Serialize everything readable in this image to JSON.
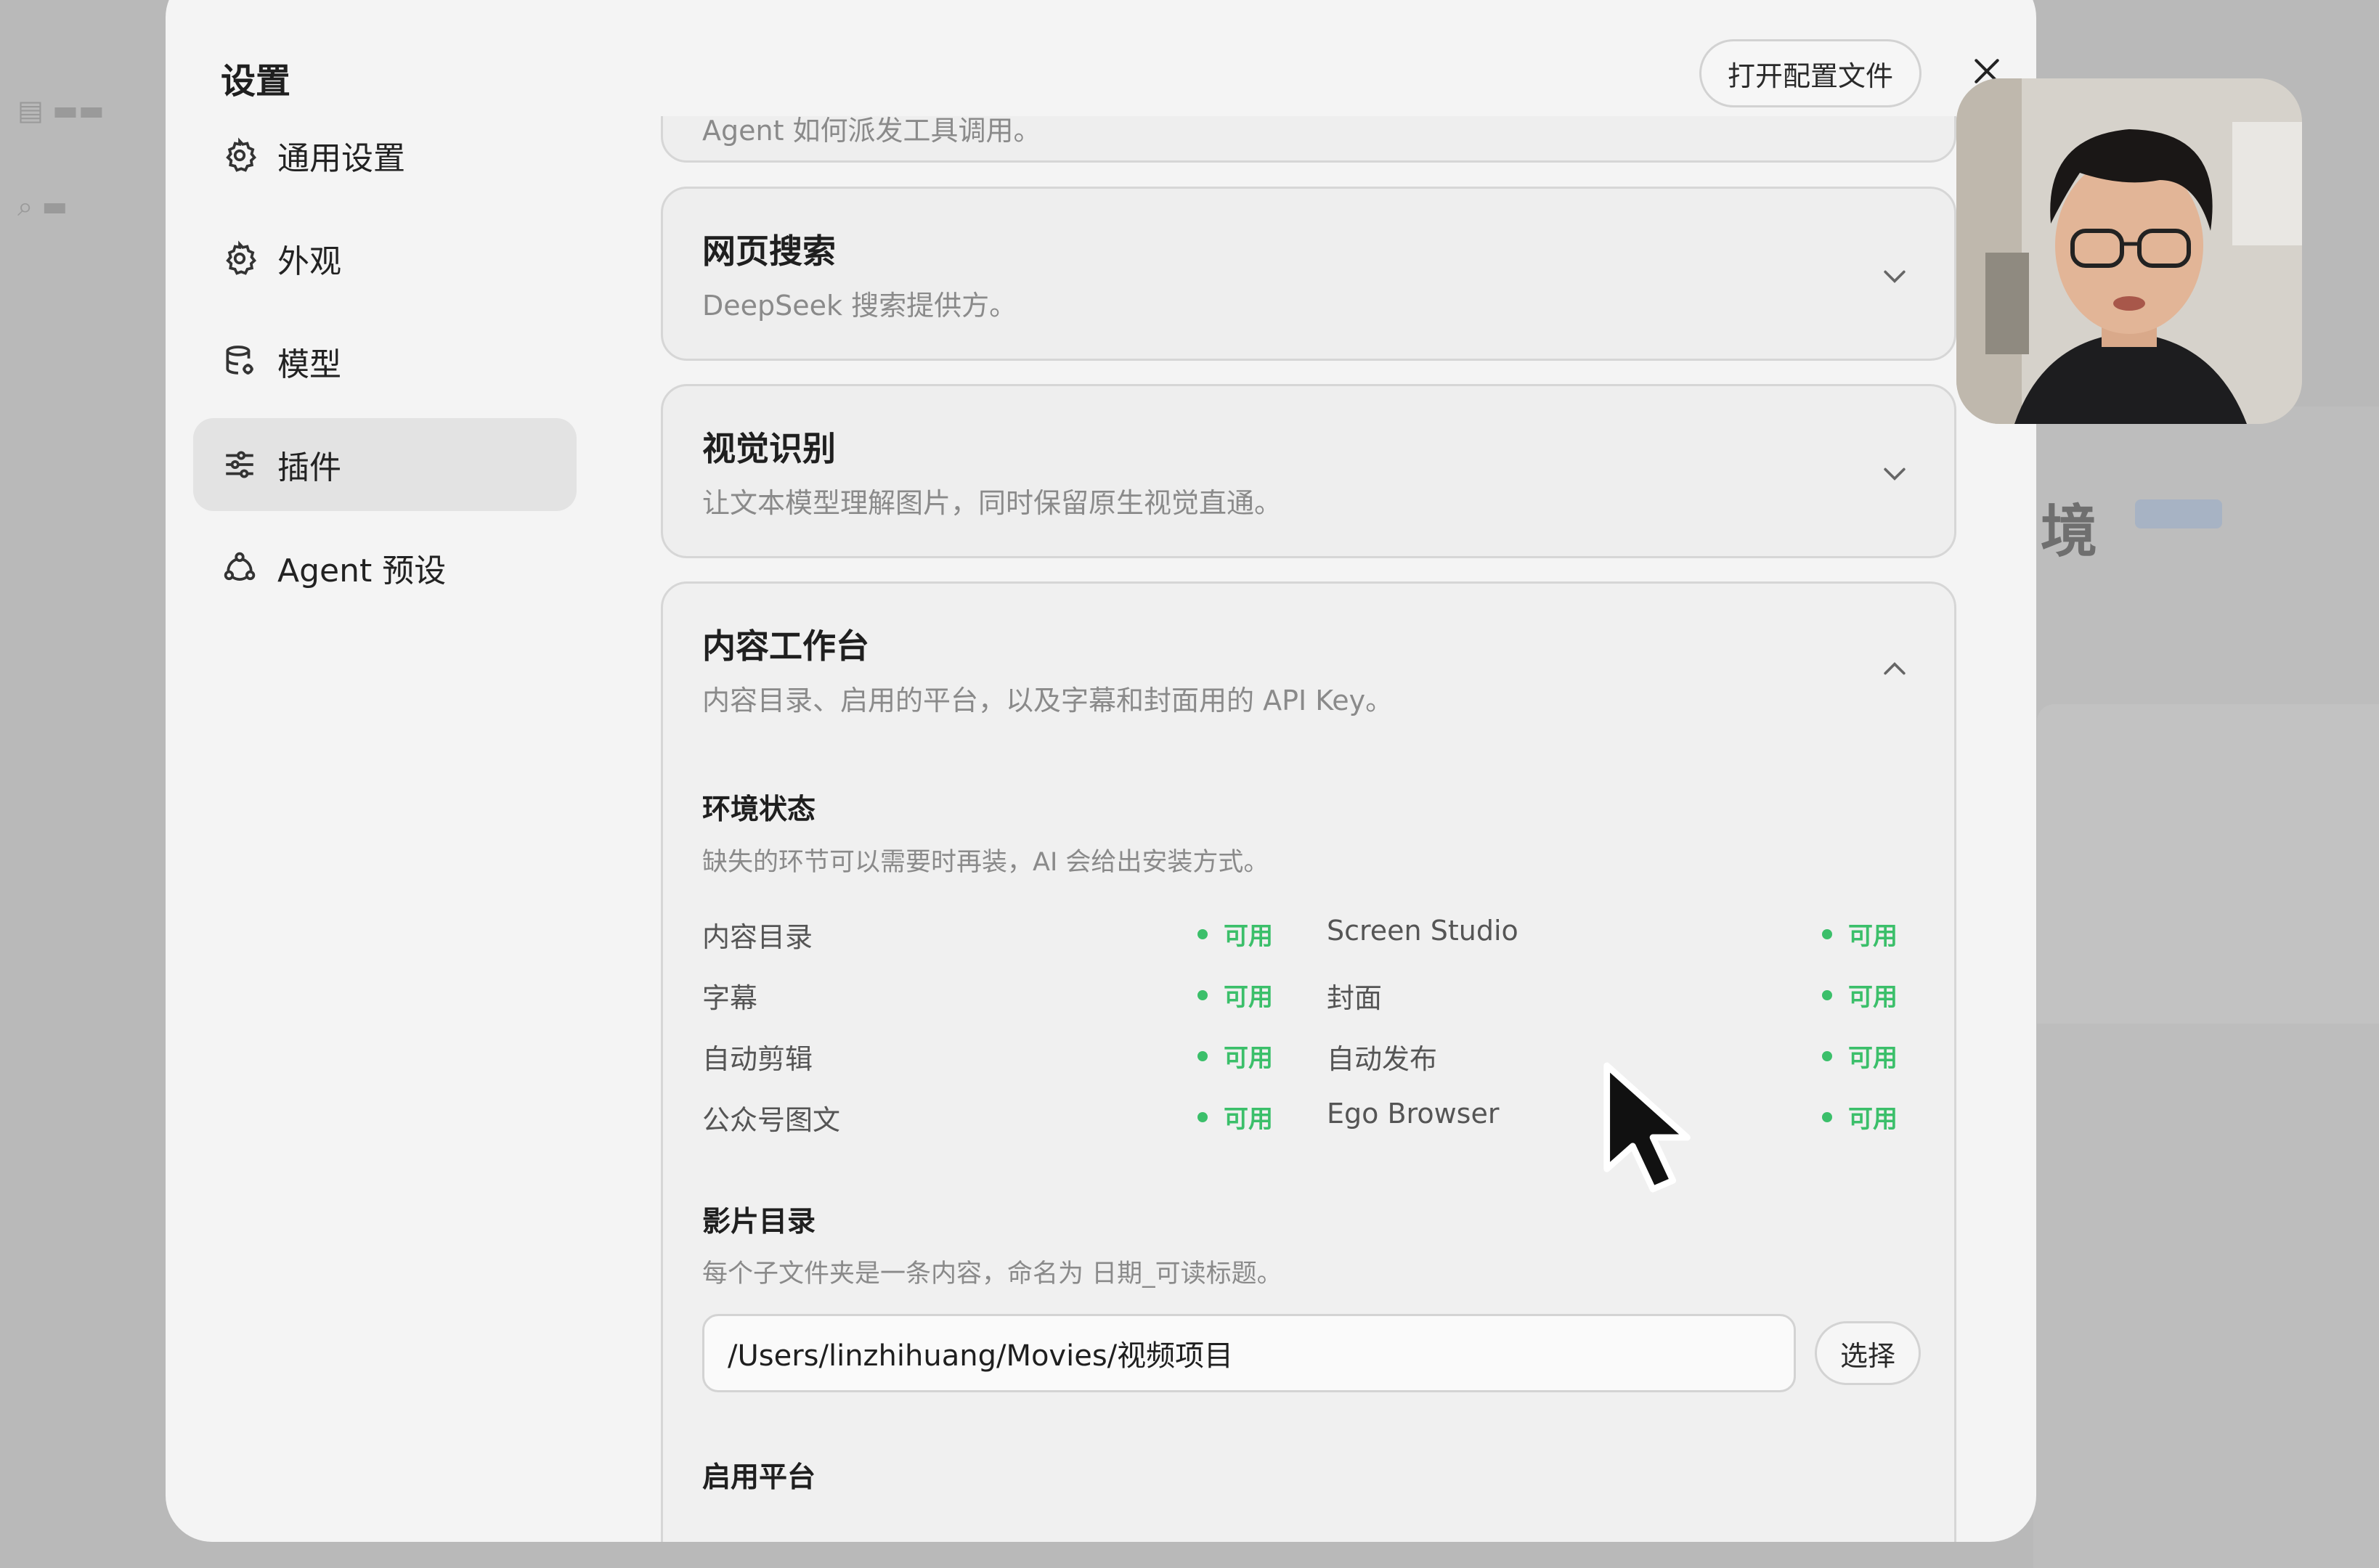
{
  "dialog": {
    "title": "设置",
    "open_config_label": "打开配置文件"
  },
  "nav": {
    "items": [
      {
        "label": "通用设置",
        "icon": "gear-icon"
      },
      {
        "label": "外观",
        "icon": "gear-icon"
      },
      {
        "label": "模型",
        "icon": "database-icon"
      },
      {
        "label": "插件",
        "icon": "sliders-icon",
        "active": true
      },
      {
        "label": "Agent 预设",
        "icon": "agent-icon"
      }
    ]
  },
  "cards": {
    "partial_desc": "Agent 如何派发工具调用。",
    "web_search": {
      "title": "网页搜索",
      "desc": "DeepSeek 搜索提供方。"
    },
    "vision": {
      "title": "视觉识别",
      "desc": "让文本模型理解图片，同时保留原生视觉直通。"
    },
    "workbench": {
      "title": "内容工作台",
      "desc": "内容目录、启用的平台，以及字幕和封面用的 API Key。",
      "env_title": "环境状态",
      "env_desc": "缺失的环节可以需要时再装，AI 会给出安装方式。",
      "status": [
        {
          "name": "内容目录",
          "value": "可用"
        },
        {
          "name": "Screen Studio",
          "value": "可用"
        },
        {
          "name": "字幕",
          "value": "可用"
        },
        {
          "name": "封面",
          "value": "可用"
        },
        {
          "name": "自动剪辑",
          "value": "可用"
        },
        {
          "name": "自动发布",
          "value": "可用"
        },
        {
          "name": "公众号图文",
          "value": "可用"
        },
        {
          "name": "Ego Browser",
          "value": "可用"
        }
      ],
      "movie_title": "影片目录",
      "movie_desc": "每个子文件夹是一条内容，命名为 日期_可读标题。",
      "movie_path": "/Users/linzhihuang/Movies/视频项目",
      "choose_label": "选择",
      "platform_title": "启用平台"
    }
  },
  "colors": {
    "available": "#3bbf6a",
    "dialog_bg": "#f4f4f4",
    "active_nav": "#e3e3e3"
  }
}
